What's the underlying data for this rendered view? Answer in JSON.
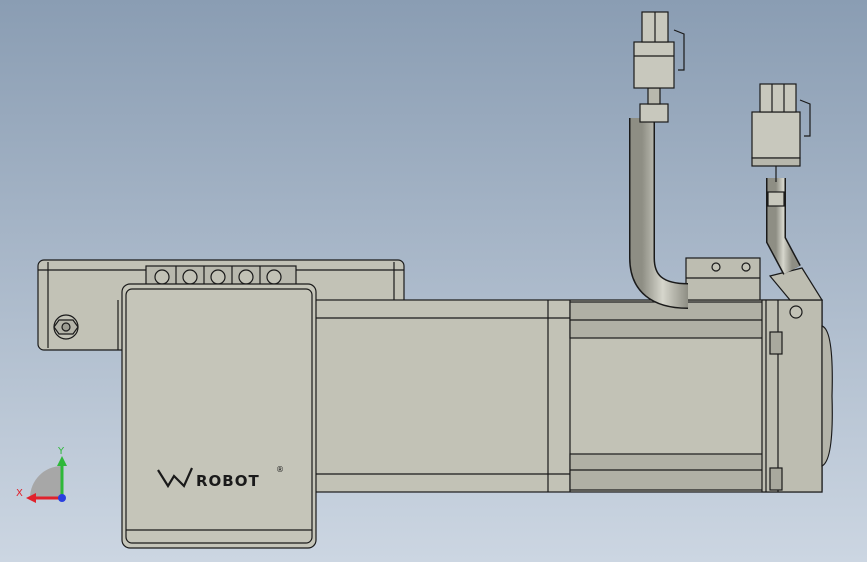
{
  "scene": {
    "background_top": "#8a9db3",
    "background_bottom": "#ccd6e2",
    "part_fill": "#c2c2b6",
    "part_shade": "#a9a99e",
    "edge_color": "#1a1a1a"
  },
  "brand": {
    "text": "ROBOT",
    "registered_mark": "®"
  },
  "triad": {
    "x_label": "X",
    "y_label": "Y",
    "x_color": "#e0212b",
    "y_color": "#2eb83a",
    "z_color": "#2a3fe0"
  }
}
